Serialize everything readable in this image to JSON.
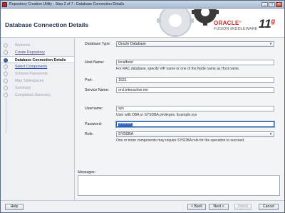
{
  "window": {
    "title": "Repository Creation Utility - Step 2 of 7 : Database Connection Details",
    "minimize_glyph": "_",
    "maximize_glyph": "□",
    "close_glyph": "×"
  },
  "header": {
    "page_title": "Database Connection Details",
    "brand": "ORACLE",
    "brand_mark": "®",
    "product_line": "FUSION MIDDLEWARE",
    "version_number": "11",
    "version_suffix": "g"
  },
  "nav": {
    "items": [
      {
        "label": "Welcome",
        "state": "pending"
      },
      {
        "label": "Create Repository",
        "state": "done"
      },
      {
        "label": "Database Connection Details",
        "state": "active"
      },
      {
        "label": "Select Components",
        "state": "next"
      },
      {
        "label": "Schema Passwords",
        "state": "pending"
      },
      {
        "label": "Map Tablespaces",
        "state": "pending"
      },
      {
        "label": "Summary",
        "state": "pending"
      },
      {
        "label": "Completion Summary",
        "state": "pending"
      }
    ]
  },
  "form": {
    "database_type": {
      "label": "Database Type:",
      "value": "Oracle Database"
    },
    "host_name": {
      "label": "Host Name:",
      "value": "localhost",
      "hint": "For RAC database, specify VIP name or one of the Node name as Host name."
    },
    "port": {
      "label": "Port:",
      "value": "1521"
    },
    "service_name": {
      "label": "Service Name:",
      "value": "orcl.interactive.mn"
    },
    "username": {
      "label": "Username:",
      "value": "sys",
      "hint": "User with DBA or SYSDBA privileges. Example:sys"
    },
    "password": {
      "label": "Password:",
      "value": "••••••••••"
    },
    "role": {
      "label": "Role:",
      "value": "SYSDBA",
      "hint": "One or more components may require SYSDBA role for the operation to succeed."
    }
  },
  "messages": {
    "label": "Messages:"
  },
  "footer": {
    "help": "Help",
    "back": "< Back",
    "next": "Next >",
    "finish": "Finish",
    "cancel": "Cancel"
  },
  "colors": {
    "accent": "#d61f1f",
    "active_dot": "#3d6ea7",
    "password_highlight": "#2f64c8"
  }
}
